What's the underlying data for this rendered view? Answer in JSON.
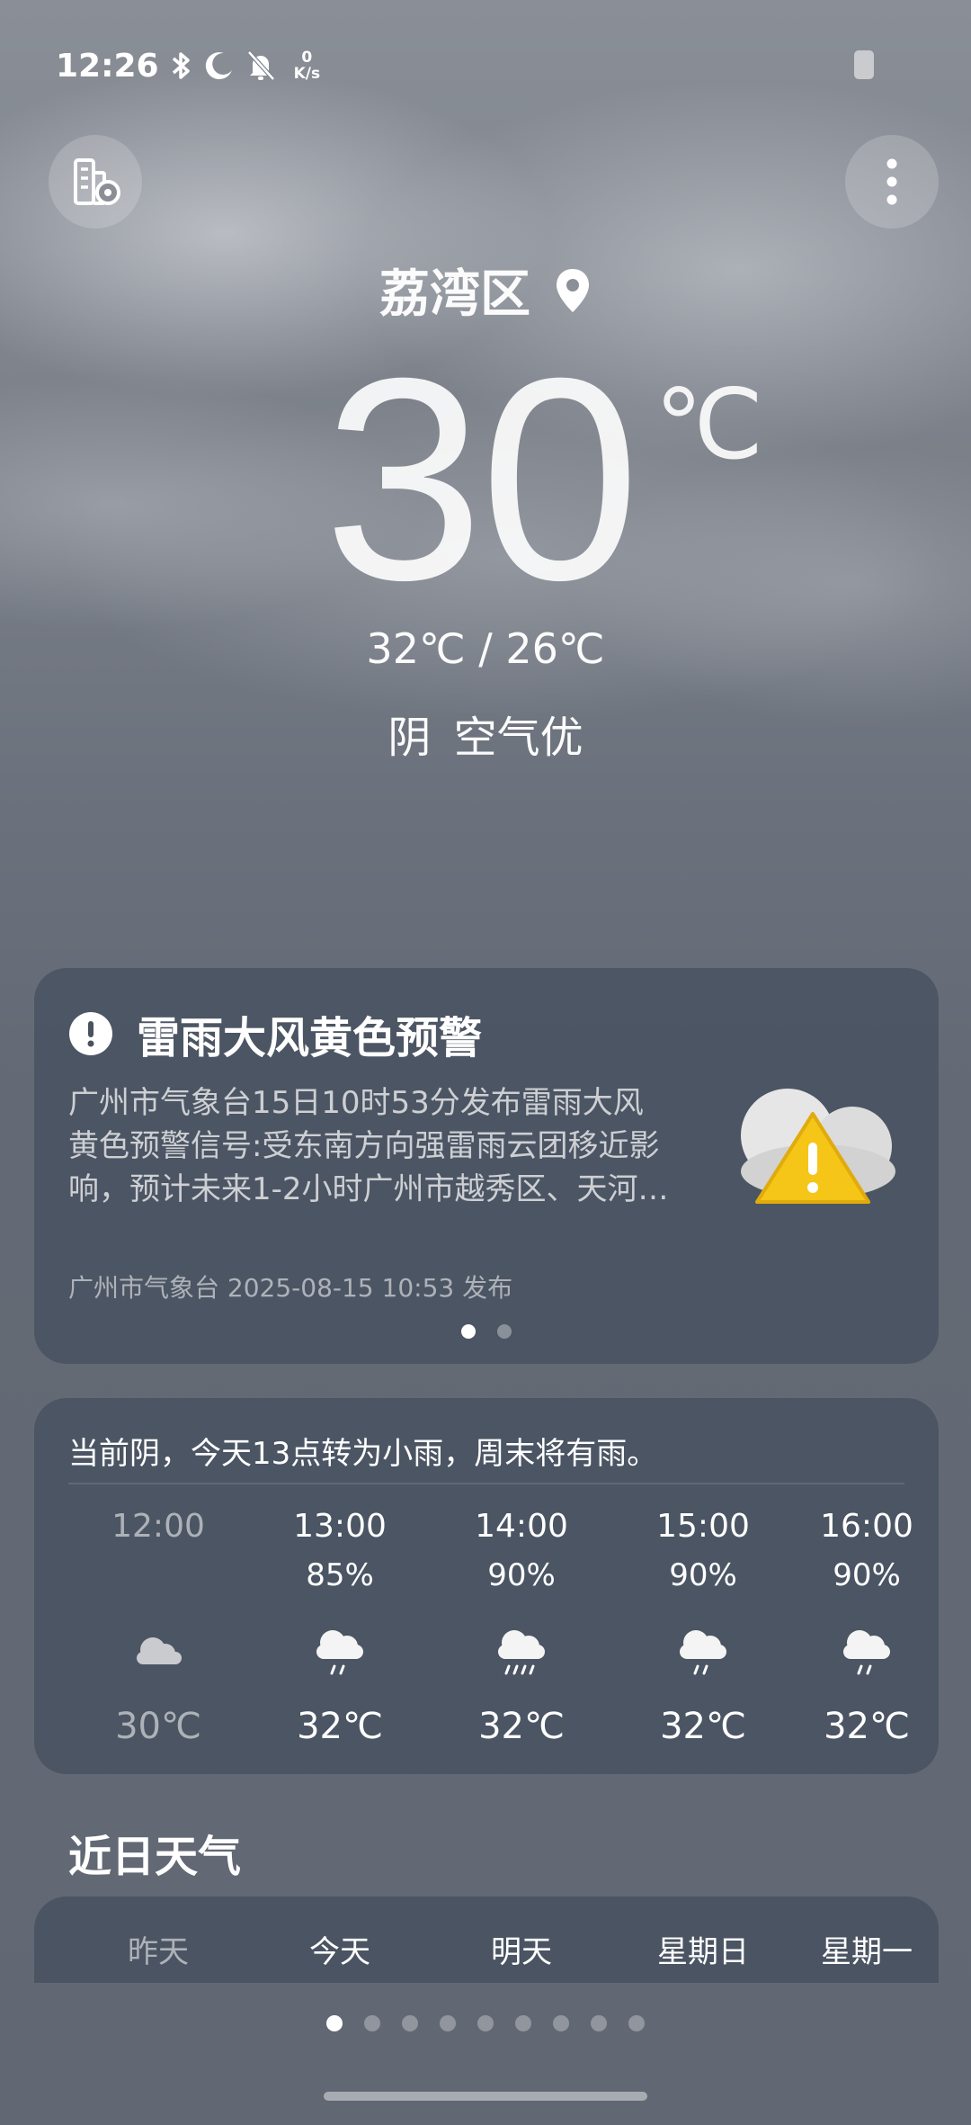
{
  "status_bar": {
    "time": "12:26",
    "net_speed_value": "0",
    "net_speed_unit": "K/s",
    "icons": [
      "bluetooth-icon",
      "moon-icon",
      "bell-off-icon"
    ]
  },
  "header": {
    "left_button_icon": "city-settings-icon",
    "right_button_icon": "more-vert-icon"
  },
  "hero": {
    "location": "荔湾区",
    "temperature": "30",
    "unit": "℃",
    "range": "32℃ / 26℃",
    "condition": "阴  空气优"
  },
  "alert": {
    "title": "雷雨大风黄色预警",
    "lines": [
      "广州市气象台15日10时53分发布雷雨大风",
      "黄色预警信号:受东南方向强雷雨云团移近影",
      "响，预计未来1-2小时广州市越秀区、天河…"
    ],
    "source": "广州市气象台 2025-08-15 10:53 发布",
    "page_count": 2,
    "active_page": 0,
    "warning_color": "#f5c518"
  },
  "hourly": {
    "summary": "当前阴，今天13点转为小雨，周末将有雨。",
    "items": [
      {
        "time": "12:00",
        "precip": "",
        "icon": "cloudy-icon",
        "temp": "30℃"
      },
      {
        "time": "13:00",
        "precip": "85%",
        "icon": "light-rain-icon",
        "temp": "32℃"
      },
      {
        "time": "14:00",
        "precip": "90%",
        "icon": "moderate-rain-icon",
        "temp": "32℃"
      },
      {
        "time": "15:00",
        "precip": "90%",
        "icon": "light-rain-icon",
        "temp": "32℃"
      },
      {
        "time": "16:00",
        "precip": "90%",
        "icon": "light-rain-icon",
        "temp": "32℃"
      }
    ]
  },
  "daily": {
    "title": "近日天气",
    "days": [
      "昨天",
      "今天",
      "明天",
      "星期日",
      "星期一"
    ]
  },
  "pager": {
    "count": 9,
    "active": 0
  }
}
